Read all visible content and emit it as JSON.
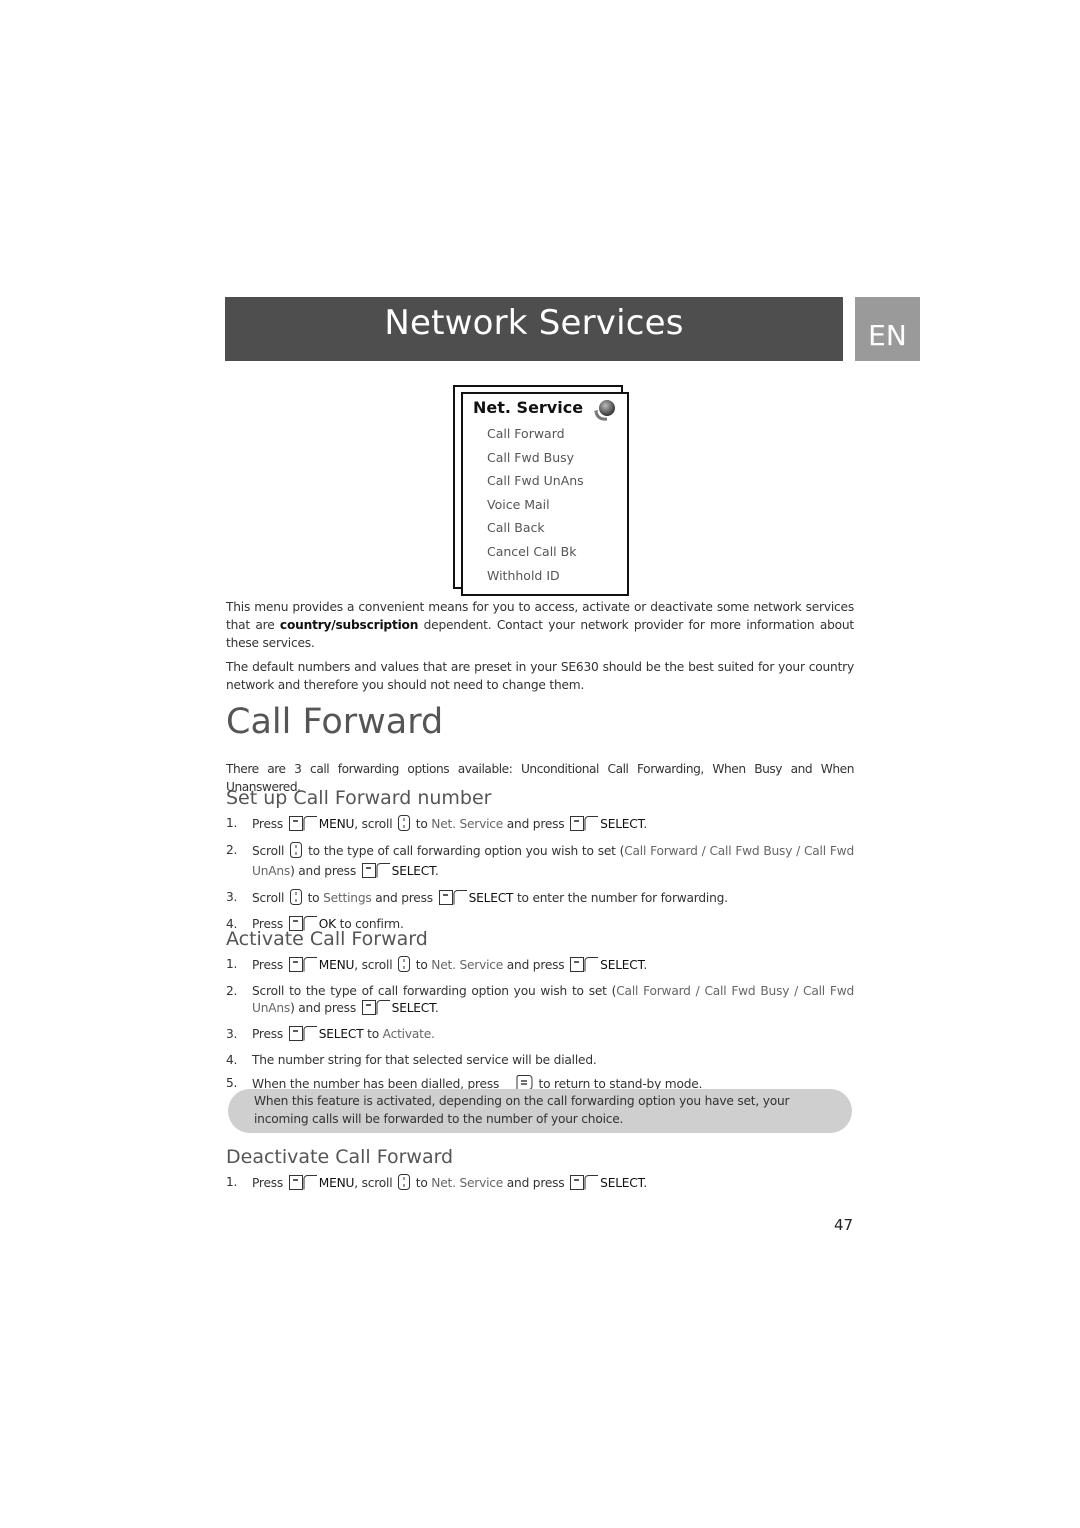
{
  "header": {
    "title": "Network Services",
    "language": "EN"
  },
  "menu_screen": {
    "title": "Net. Service",
    "icon": "globe-icon",
    "items": [
      "Call Forward",
      "Call Fwd Busy",
      "Call Fwd UnAns",
      "Voice Mail",
      "Call Back",
      "Cancel Call Bk",
      "Withhold ID"
    ]
  },
  "intro": {
    "p1_before": "This menu provides a convenient means for you to access, activate or deactivate some network services that are ",
    "p1_bold": "country/subscription",
    "p1_after": " dependent. Contact your network provider for more information about these services.",
    "p2": "The default numbers and values that are preset in your SE630 should be the best suited for your country network and therefore you should not need to change them."
  },
  "call_forward": {
    "title": "Call Forward",
    "description": "There are 3 call forwarding options available: Unconditional Call Forwarding, When Busy and When Unanswered.",
    "setup": {
      "title": "Set up Call Forward number",
      "steps": [
        {
          "num": "1.",
          "a": "Press",
          "k1": "MENU",
          "b": ", scroll",
          "c": "to",
          "ref": "Net. Service",
          "d": "and press",
          "k2": "SELECT",
          "e": "."
        },
        {
          "num": "2.",
          "a": "Scroll",
          "b": "to the type of call forwarding option you wish to set (",
          "ref": "Call Forward / Call Fwd Busy / Call Fwd UnAns",
          "c": ") and press",
          "k1": "SELECT",
          "d": "."
        },
        {
          "num": "3.",
          "a": "Scroll",
          "b": "to",
          "ref": "Settings",
          "c": "and press",
          "k1": "SELECT",
          "d": "to enter the number for forwarding."
        },
        {
          "num": "4.",
          "a": "Press",
          "k1": "OK",
          "b": "to confirm."
        }
      ]
    },
    "activate": {
      "title": "Activate Call Forward",
      "steps": [
        {
          "num": "1.",
          "a": "Press",
          "k1": "MENU",
          "b": ", scroll",
          "c": "to",
          "ref": "Net. Service",
          "d": "and press",
          "k2": "SELECT",
          "e": "."
        },
        {
          "num": "2.",
          "a": "Scroll to the type of call forwarding option you wish to set (",
          "ref": "Call Forward / Call Fwd Busy / Call Fwd UnAns",
          "b": ") and press",
          "k1": "SELECT",
          "c": "."
        },
        {
          "num": "3.",
          "a": "Press",
          "k1": "SELECT",
          "b": "to",
          "ref": "Activate",
          "c": "."
        },
        {
          "num": "4.",
          "a": "The number string for that selected service will be dialled."
        },
        {
          "num": "5.",
          "a": "When the number has been dialled, press",
          "b": "to return to stand-by mode."
        }
      ]
    },
    "note": "When this feature is activated, depending on the call forwarding option you have set, your incoming calls will be forwarded to the number of your choice.",
    "deactivate": {
      "title": "Deactivate Call Forward",
      "steps": [
        {
          "num": "1.",
          "a": "Press",
          "k1": "MENU",
          "b": ", scroll",
          "c": "to",
          "ref": "Net. Service",
          "d": "and press",
          "k2": "SELECT",
          "e": "."
        }
      ]
    }
  },
  "page_number": "47"
}
